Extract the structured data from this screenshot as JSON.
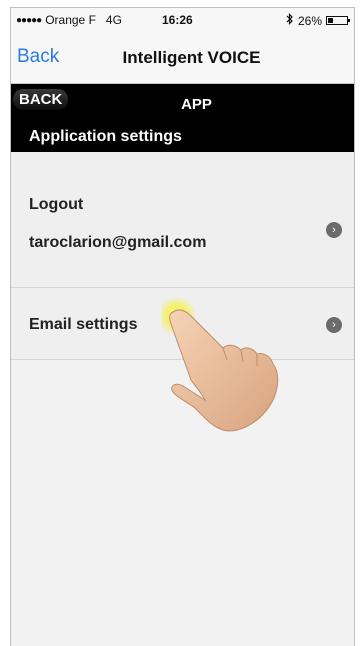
{
  "status_bar": {
    "carrier": "Orange F",
    "network": "4G",
    "time": "16:26",
    "bluetooth_icon": "bluetooth-icon",
    "battery_percent": "26%",
    "battery_level": 0.26
  },
  "nav": {
    "back_label": "Back",
    "title": "Intelligent VOICE"
  },
  "app_bar": {
    "back_label": "BACK",
    "title": "APP",
    "subtitle": "Application settings"
  },
  "settings": {
    "items": [
      {
        "label": "Logout",
        "value": "taroclarion@gmail.com"
      },
      {
        "label": "Email settings"
      }
    ]
  }
}
